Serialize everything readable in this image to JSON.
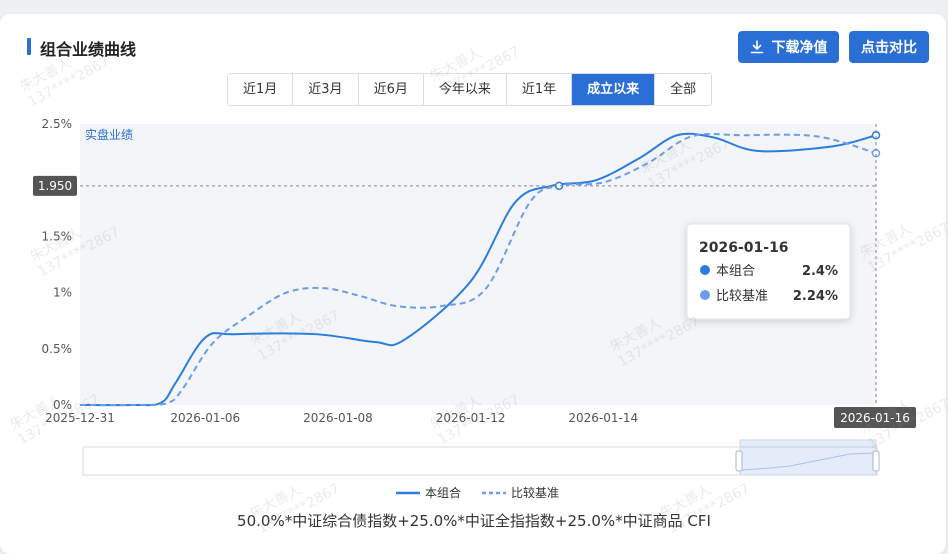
{
  "header": {
    "title": "组合业绩曲线",
    "download_label": "下载净值",
    "compare_label": "点击对比"
  },
  "range_tabs": [
    "近1月",
    "近3月",
    "近6月",
    "今年以来",
    "近1年",
    "成立以来",
    "全部"
  ],
  "active_range": "成立以来",
  "watermark": {
    "name": "朱大善人",
    "phone": "137****2867"
  },
  "chart_data": {
    "type": "line",
    "annotation": "实盘业绩",
    "x_labels": [
      "2025-12-31",
      "2026-01-06",
      "2026-01-08",
      "2026-01-12",
      "2026-01-14",
      "2026-01-16"
    ],
    "y_ticks": [
      "0%",
      "0.5%",
      "1%",
      "1.5%",
      "2%",
      "2.5%"
    ],
    "ylim": [
      0,
      2.5
    ],
    "crosshair_y_label": "1.950",
    "crosshair_x_label": "2026-01-16",
    "series": [
      {
        "name": "本组合",
        "color": "#2a7ee0",
        "style": "solid",
        "points": [
          [
            0,
            0
          ],
          [
            0.7,
            0
          ],
          [
            1.1,
            0.02
          ],
          [
            1.3,
            0.2
          ],
          [
            1.7,
            0.6
          ],
          [
            2.1,
            0.63
          ],
          [
            3.2,
            0.63
          ],
          [
            4.0,
            0.56
          ],
          [
            4.4,
            0.58
          ],
          [
            5.3,
            1.1
          ],
          [
            5.9,
            1.8
          ],
          [
            6.4,
            1.95
          ],
          [
            7.0,
            2.0
          ],
          [
            7.6,
            2.2
          ],
          [
            8.1,
            2.4
          ],
          [
            8.6,
            2.38
          ],
          [
            9.2,
            2.26
          ],
          [
            10.2,
            2.3
          ],
          [
            10.8,
            2.4
          ]
        ]
      },
      {
        "name": "比较基准",
        "color": "#6a9eea",
        "style": "dashed",
        "points": [
          [
            0,
            0
          ],
          [
            0.8,
            0
          ],
          [
            1.2,
            0.02
          ],
          [
            1.4,
            0.15
          ],
          [
            1.8,
            0.55
          ],
          [
            2.3,
            0.8
          ],
          [
            2.8,
            1.0
          ],
          [
            3.3,
            1.04
          ],
          [
            3.8,
            0.97
          ],
          [
            4.3,
            0.88
          ],
          [
            4.9,
            0.88
          ],
          [
            5.5,
            1.03
          ],
          [
            6.1,
            1.8
          ],
          [
            6.5,
            1.95
          ],
          [
            7.1,
            1.98
          ],
          [
            7.7,
            2.15
          ],
          [
            8.3,
            2.39
          ],
          [
            9.0,
            2.4
          ],
          [
            10.0,
            2.39
          ],
          [
            10.8,
            2.24
          ]
        ]
      }
    ],
    "tooltip": {
      "date": "2026-01-16",
      "rows": [
        {
          "name": "本组合",
          "value": "2.4%"
        },
        {
          "name": "比较基准",
          "value": "2.24%"
        }
      ]
    },
    "legend": {
      "position": "bottom"
    }
  },
  "benchmark_formula": "50.0%*中证综合债指数+25.0%*中证全指指数+25.0%*中证商品 CFI"
}
